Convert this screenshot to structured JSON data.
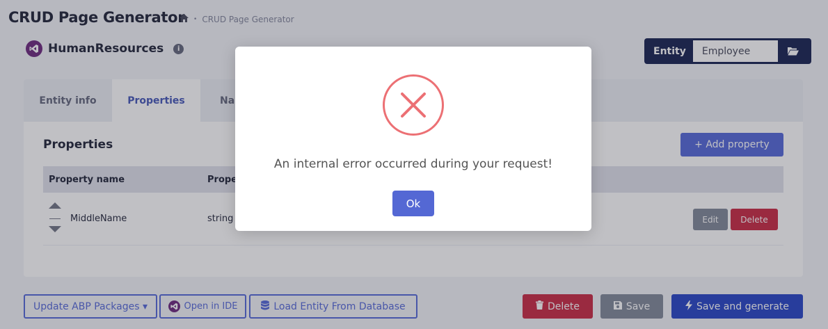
{
  "header": {
    "title": "CRUD Page Generator",
    "breadcrumb": {
      "home_icon": "home-icon",
      "separator": "•",
      "current": "CRUD Page Generator"
    }
  },
  "solution": {
    "logo_icon": "visual-studio-icon",
    "name": "HumanResources",
    "info_icon": "info-icon"
  },
  "entity_selector": {
    "label": "Entity",
    "value": "Employee",
    "folder_icon": "folder-open-icon"
  },
  "tabs": [
    {
      "label": "Entity info",
      "active": false
    },
    {
      "label": "Properties",
      "active": true
    },
    {
      "label": "Na",
      "active": false
    }
  ],
  "properties": {
    "title": "Properties",
    "add_label": "+ Add property",
    "columns": [
      "Property name",
      "Prope"
    ],
    "rows": [
      {
        "name": "MiddleName",
        "type": "string",
        "edit_label": "Edit",
        "delete_label": "Delete"
      }
    ]
  },
  "footer": {
    "update_label": "Update ABP Packages ▾",
    "open_ide_label": "Open in IDE",
    "load_entity_label": "Load Entity From Database",
    "delete_label": "Delete",
    "save_label": "Save",
    "save_generate_label": "Save and generate"
  },
  "modal": {
    "icon": "error-x-icon",
    "message": "An internal error occurred during your request!",
    "ok_label": "Ok",
    "accent_color": "#ec7074"
  }
}
